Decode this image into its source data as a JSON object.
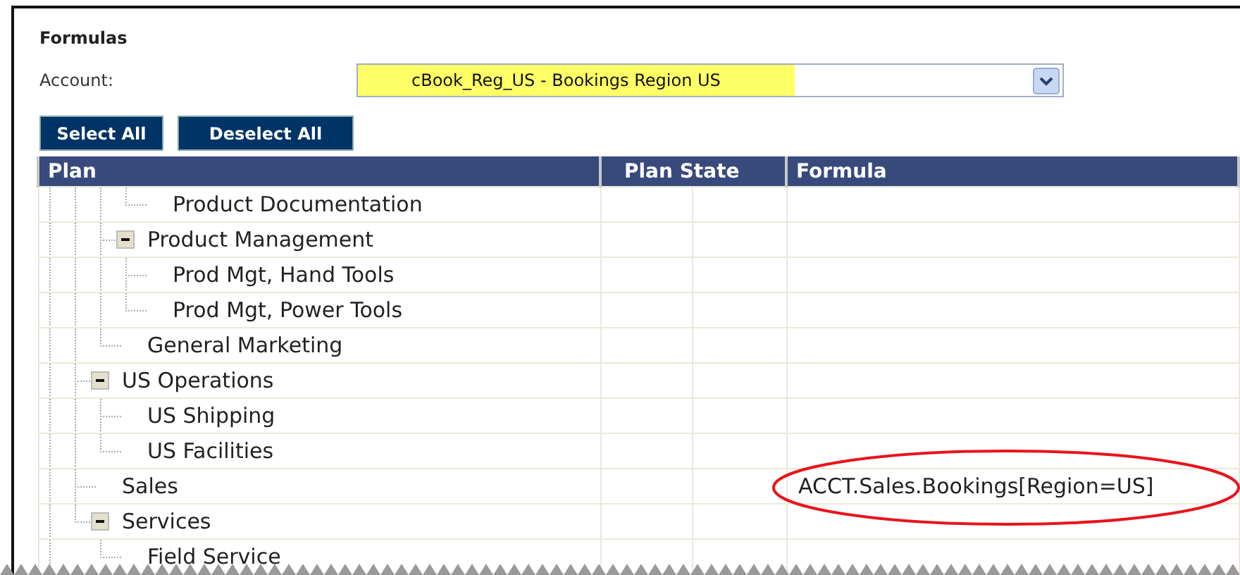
{
  "section": {
    "title": "Formulas"
  },
  "account": {
    "label": "Account:",
    "value": "cBook_Reg_US - Bookings Region US",
    "highlighted": true
  },
  "buttons": [
    "Select All",
    "Deselect All"
  ],
  "table": {
    "columns": [
      "Plan",
      "Plan State",
      "Formula"
    ],
    "tree": [
      {
        "children": [
          {
            "children": [
              {
                "children": [
                  {
                    "label": "Product Documentation"
                  }
                ]
              },
              {
                "label": "Product Management",
                "expanded": true,
                "children": [
                  {
                    "label": "Prod Mgt, Hand Tools"
                  },
                  {
                    "label": "Prod Mgt, Power Tools"
                  }
                ]
              },
              {
                "label": "General Marketing"
              }
            ]
          },
          {
            "label": "US Operations",
            "expanded": true,
            "children": [
              {
                "label": "US Shipping"
              },
              {
                "label": "US Facilities"
              }
            ]
          },
          {
            "label": "Sales",
            "formula": "ACCT.Sales.Bookings[Region=US]",
            "circled": true
          },
          {
            "label": "Services",
            "expanded": true,
            "children": [
              {
                "label": "Field Service"
              }
            ]
          }
        ]
      }
    ]
  }
}
